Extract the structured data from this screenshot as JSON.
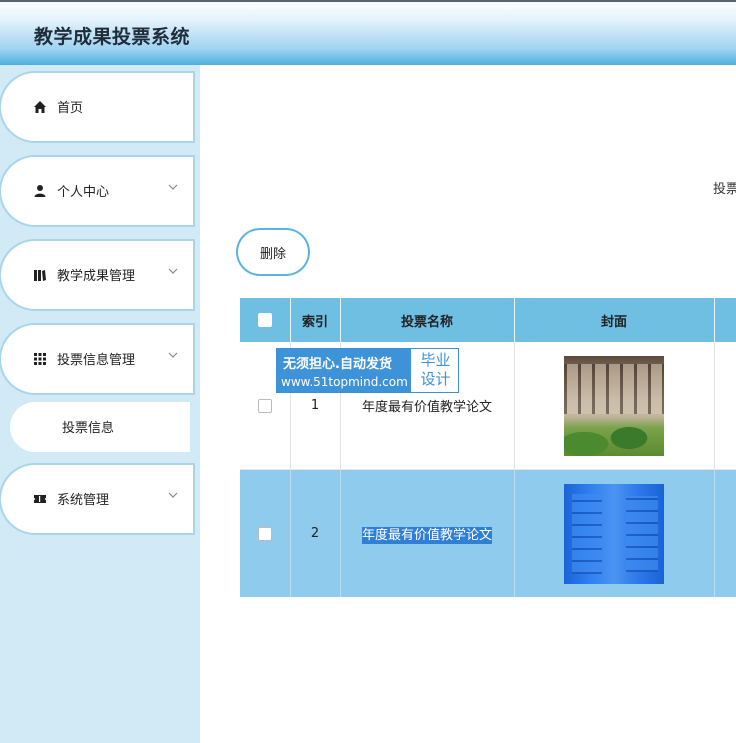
{
  "header": {
    "title": "教学成果投票系统"
  },
  "sidebar": {
    "items": [
      {
        "label": "首页",
        "icon": "home-icon",
        "has_children": false
      },
      {
        "label": "个人中心",
        "icon": "user-icon",
        "has_children": true
      },
      {
        "label": "教学成果管理",
        "icon": "book-icon",
        "has_children": true
      },
      {
        "label": "投票信息管理",
        "icon": "grid-icon",
        "has_children": true
      },
      {
        "label": "系统管理",
        "icon": "ticket-icon",
        "has_children": true
      }
    ],
    "subitem": {
      "label": "投票信息"
    }
  },
  "main": {
    "partial_text": "投票",
    "delete_label": "删除",
    "table": {
      "columns": [
        "",
        "索引",
        "投票名称",
        "封面",
        ""
      ],
      "rows": [
        {
          "index": "1",
          "name": "年度最有价值教学论文",
          "selected": false
        },
        {
          "index": "2",
          "name": "年度最有价值教学论文",
          "selected": true
        }
      ]
    }
  },
  "watermark": {
    "line1": "无须担心.自动发货",
    "line2": "www.51topmind.com",
    "right_line1": "毕业",
    "right_line2": "设计"
  },
  "colors": {
    "accent": "#6fbfe3",
    "sidebar_bg": "#d1eaf5",
    "selected_row": "#8fcbec",
    "selection": "#2f7fd6"
  }
}
